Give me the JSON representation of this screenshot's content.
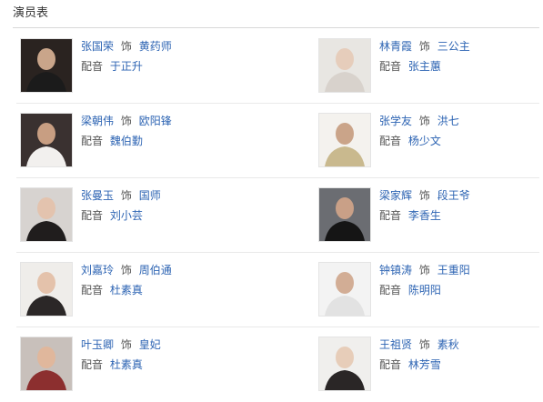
{
  "section_title": "演员表",
  "cast": [
    {
      "left": {
        "actor": "张国荣",
        "role_word": "饰",
        "role": "黄药师",
        "dub_word": "配音",
        "voice": "于正升",
        "bg": "#2a2320",
        "skin": "#c9a58a",
        "cloth": "#1b1b1b"
      },
      "right": {
        "actor": "林青霞",
        "role_word": "饰",
        "role": "三公主",
        "dub_word": "配音",
        "voice": "张主蕙",
        "bg": "#e8e6e2",
        "skin": "#e6cdbb",
        "cloth": "#d8d2cc"
      }
    },
    {
      "left": {
        "actor": "梁朝伟",
        "role_word": "饰",
        "role": "欧阳锋",
        "dub_word": "配音",
        "voice": "魏伯勤",
        "bg": "#3a3130",
        "skin": "#c89e82",
        "cloth": "#f2f0ee"
      },
      "right": {
        "actor": "张学友",
        "role_word": "饰",
        "role": "洪七",
        "dub_word": "配音",
        "voice": "杨少文",
        "bg": "#f4f2ee",
        "skin": "#caa489",
        "cloth": "#c9b98e"
      }
    },
    {
      "left": {
        "actor": "张曼玉",
        "role_word": "饰",
        "role": "国师",
        "dub_word": "配音",
        "voice": "刘小芸",
        "bg": "#d7d3d0",
        "skin": "#e3c3ae",
        "cloth": "#201d1d"
      },
      "right": {
        "actor": "梁家辉",
        "role_word": "饰",
        "role": "段王爷",
        "dub_word": "配音",
        "voice": "李香生",
        "bg": "#6b6d72",
        "skin": "#c9a087",
        "cloth": "#151515"
      }
    },
    {
      "left": {
        "actor": "刘嘉玲",
        "role_word": "饰",
        "role": "周伯通",
        "dub_word": "配音",
        "voice": "杜素真",
        "bg": "#efedea",
        "skin": "#e4c2ab",
        "cloth": "#2b2727"
      },
      "right": {
        "actor": "钟镇涛",
        "role_word": "饰",
        "role": "王重阳",
        "dub_word": "配音",
        "voice": "陈明阳",
        "bg": "#f3f3f3",
        "skin": "#d2ad95",
        "cloth": "#e2e2e2"
      }
    },
    {
      "left": {
        "actor": "叶玉卿",
        "role_word": "饰",
        "role": "皇妃",
        "dub_word": "配音",
        "voice": "杜素真",
        "bg": "#c8c0bb",
        "skin": "#e0b79c",
        "cloth": "#8c2f2f"
      },
      "right": {
        "actor": "王祖贤",
        "role_word": "饰",
        "role": "素秋",
        "dub_word": "配音",
        "voice": "林芳雪",
        "bg": "#f0efed",
        "skin": "#e7cdb9",
        "cloth": "#2a2626"
      }
    }
  ]
}
